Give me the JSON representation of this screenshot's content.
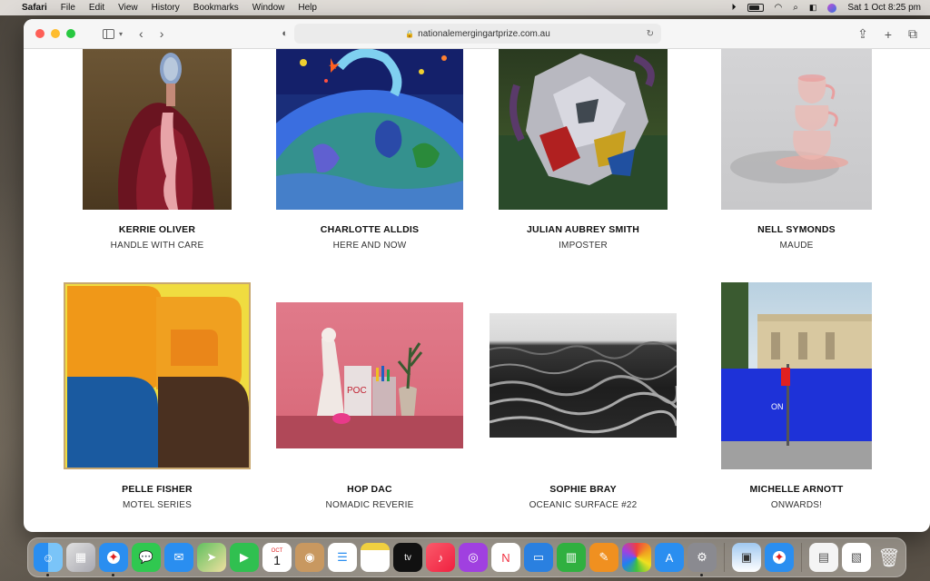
{
  "menubar": {
    "app": "Safari",
    "items": [
      "File",
      "Edit",
      "View",
      "History",
      "Bookmarks",
      "Window",
      "Help"
    ],
    "datetime": "Sat 1 Oct  8:25 pm"
  },
  "browser": {
    "url": "nationalemergingartprize.com.au"
  },
  "artworks": [
    {
      "artist": "KERRIE OLIVER",
      "title": "HANDLE WITH CARE"
    },
    {
      "artist": "CHARLOTTE ALLDIS",
      "title": "HERE AND NOW"
    },
    {
      "artist": "JULIAN AUBREY SMITH",
      "title": "IMPOSTER"
    },
    {
      "artist": "NELL SYMONDS",
      "title": "MAUDE"
    },
    {
      "artist": "PELLE FISHER",
      "title": "MOTEL SERIES"
    },
    {
      "artist": "HOP DAC",
      "title": "NOMADIC REVERIE"
    },
    {
      "artist": "SOPHIE BRAY",
      "title": "OCEANIC SURFACE #22"
    },
    {
      "artist": "MICHELLE ARNOTT",
      "title": "ONWARDS!"
    }
  ],
  "dock": {
    "calendar_month": "OCT",
    "calendar_day": "1",
    "tv_label": "tv"
  },
  "colors": {
    "accent_red": "#fe5f57",
    "accent_yellow": "#febc2e",
    "accent_green": "#28c840"
  }
}
